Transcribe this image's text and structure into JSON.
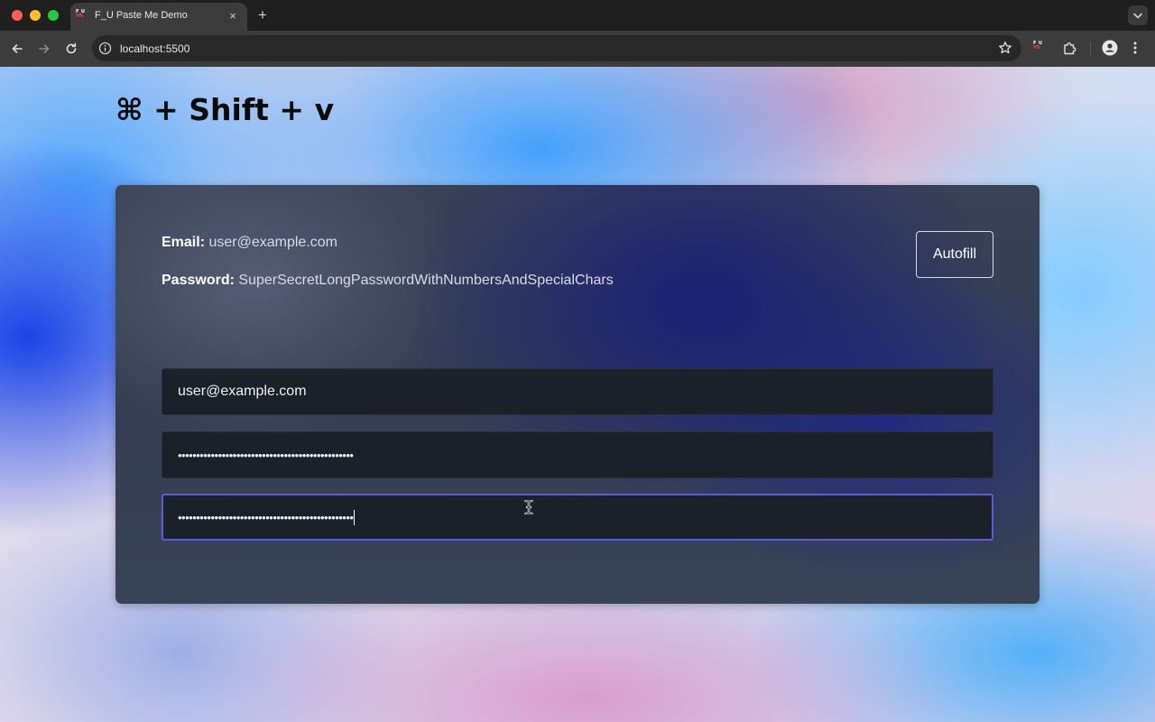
{
  "browser": {
    "tab_title": "F_U Paste Me Demo",
    "tab_favicon_top": "F_U",
    "tab_favicon_bottom": "Me",
    "tab_close": "×",
    "new_tab": "+",
    "url": "localhost:5500",
    "icons": [
      "back-arrow-icon",
      "forward-arrow-icon",
      "reload-icon",
      "info-icon",
      "star-icon",
      "extension-icon",
      "puzzle-icon",
      "profile-icon",
      "menu-icon",
      "chevron-down-icon"
    ]
  },
  "page": {
    "heading": "⌘ + Shift + v",
    "credentials": {
      "email_label": "Email:",
      "email_value": "user@example.com",
      "password_label": "Password:",
      "password_value": "SuperSecretLongPasswordWithNumbersAndSpecialChars"
    },
    "autofill_label": "Autofill",
    "fields": {
      "email_value": "user@example.com",
      "password_masked": "••••••••••••••••••••••••••••••••••••••••••••••••",
      "confirm_masked": "••••••••••••••••••••••••••••••••••••••••••••••••"
    }
  },
  "colors": {
    "focus_border": "#5e5ad8",
    "field_bg": "#1b2029",
    "card_bg": "#343d52"
  }
}
